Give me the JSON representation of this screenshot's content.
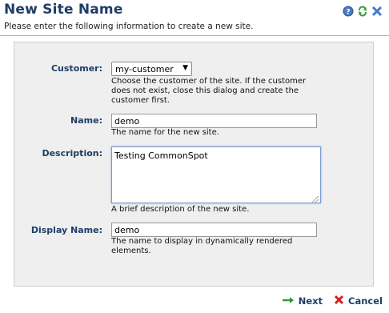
{
  "header": {
    "title": "New Site Name",
    "subtitle": "Please enter the following information to create a new site.",
    "icons": [
      "help-icon",
      "refresh-icon",
      "close-icon"
    ]
  },
  "form": {
    "customer": {
      "label": "Customer:",
      "value": "my-customer",
      "help": [
        "Choose the customer of the site. If the customer",
        "does not exist, close this dialog and create the",
        "customer first."
      ]
    },
    "name": {
      "label": "Name:",
      "value": "demo",
      "help": [
        "The name for the new site."
      ]
    },
    "description": {
      "label": "Description:",
      "value": "Testing CommonSpot",
      "help": [
        "A brief description of the new site."
      ]
    },
    "display_name": {
      "label": "Display Name:",
      "value": "demo",
      "help": [
        "The name to display in dynamically rendered",
        "elements."
      ]
    }
  },
  "footer": {
    "next_label": "Next",
    "cancel_label": "Cancel"
  },
  "colors": {
    "title": "#1f3d66",
    "panel_bg": "#efefef",
    "next_arrow": "#2e9a3a",
    "cancel_x": "#d02020"
  }
}
